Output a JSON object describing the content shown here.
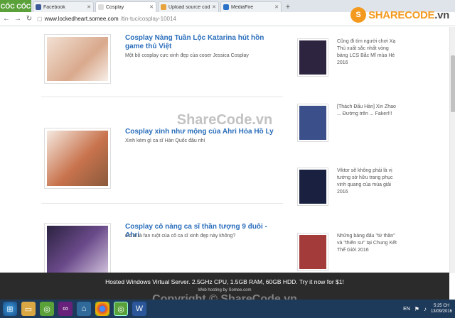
{
  "browser": {
    "logo": "CỐC CỐC",
    "tabs": [
      {
        "label": "Facebook",
        "color": "#3b5998",
        "active": false
      },
      {
        "label": "Cosplay",
        "color": "#ffffff",
        "active": true
      },
      {
        "label": "Upload source code",
        "color": "#e8a33c",
        "active": false
      },
      {
        "label": "MediaFire",
        "color": "#2a72c9",
        "active": false
      }
    ],
    "new_tab": "+",
    "url_host": "www.lockedheart.somee.com",
    "url_path": "/tin-tuc/cosplay-10014"
  },
  "brand": {
    "letter": "S",
    "name_a": "SHARECODE",
    "name_b": ".vn"
  },
  "articles": [
    {
      "title": "Cosplay Nàng Tuần Lộc Katarina hút hồn game thủ Việt",
      "desc": "Một bộ cosplay cực xinh đẹp của coser Jessica Cosplay",
      "color": "#e9d2c2"
    },
    {
      "title": "Cosplay xinh như mộng của Ahri Hỏa Hồ Ly",
      "desc": "Xinh kém gì ca sĩ Hàn Quốc đâu nhỉ",
      "color": "#d9a48a"
    },
    {
      "title": "Cosplay cô nàng ca sĩ thần tượng 9 đuôi - Ahri",
      "desc": "Có ai là fan ruột của cô ca sĩ xinh đẹp này không?",
      "color": "#4a3b66"
    }
  ],
  "sidebar": [
    {
      "text": "Cũng đi tìm người chơi Xạ Thủ xuất sắc nhất vòng bảng LCS Bắc Mĩ mùa Hè 2016",
      "color": "#2d2440"
    },
    {
      "text": "[Thách Đấu Hàn] Xin Zhao ... Đường trên ... Faker!!!",
      "color": "#3b4f8a"
    },
    {
      "text": "Viktor sẽ không phải là vị tướng sở hữu trang phục vinh quang của mùa giải 2016",
      "color": "#1a2040"
    },
    {
      "text": "Những bảng đấu \"tử thần\" và \"thiên sư\" tại Chung Kết Thế Giới 2016",
      "color": "#a33b3b"
    }
  ],
  "watermark": "ShareCode.vn",
  "ad": {
    "line1": "Hosted Windows Virtual Server. 2.5GHz CPU, 1.5GB RAM, 60GB HDD. Try it now for $1!",
    "line2": "Web hosting by Somee.com"
  },
  "footer_watermark": "Copyright © ShareCode.vn",
  "taskbar": {
    "icons": [
      "start",
      "explorer",
      "coccoc",
      "visual-studio",
      "network",
      "chrome",
      "coccoc-2",
      "word"
    ],
    "lang": "EN",
    "time": "5:25 CH",
    "date": "13/09/2016"
  }
}
